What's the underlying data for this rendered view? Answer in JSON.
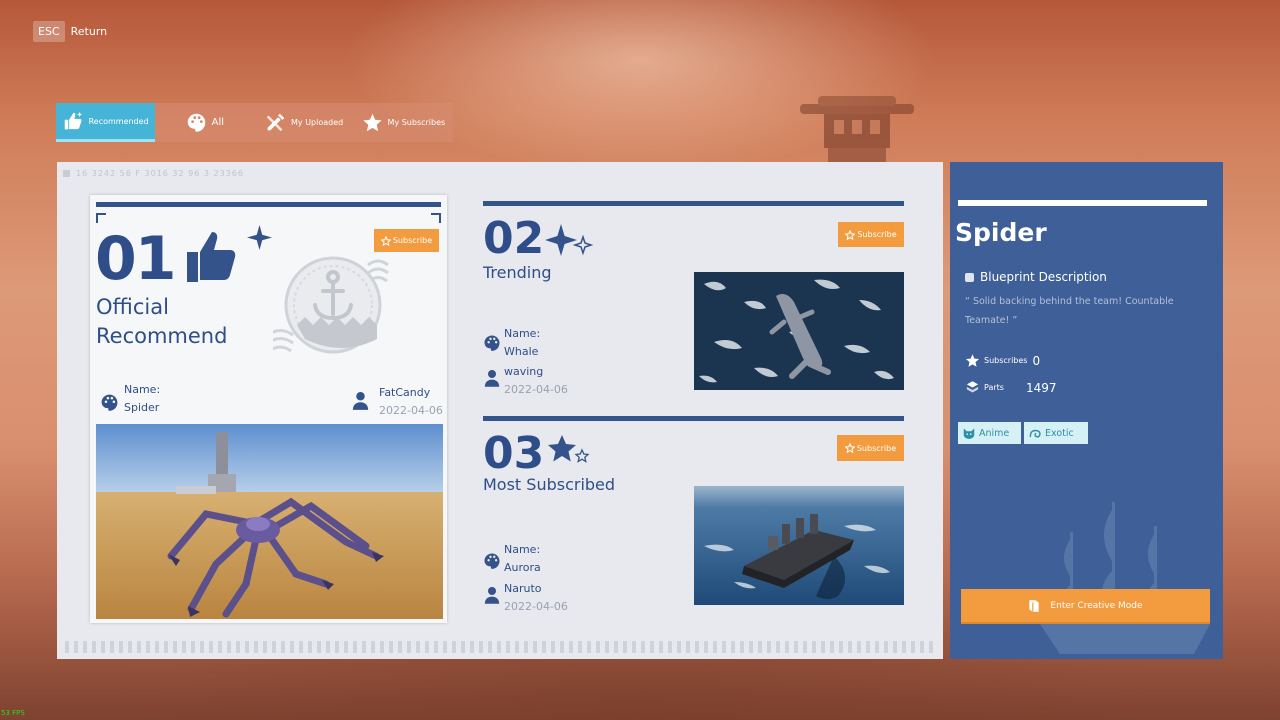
{
  "topbar": {
    "key": "ESC",
    "return_label": "Return"
  },
  "tabs": [
    {
      "label": "Recommended",
      "icon": "thumbs-up-icon",
      "active": true
    },
    {
      "label": "All",
      "icon": "palette-icon",
      "active": false
    },
    {
      "label": "My Uploaded",
      "icon": "pencil-ruler-icon",
      "active": false
    },
    {
      "label": "My Subscribes",
      "icon": "star-icon",
      "active": false
    }
  ],
  "panel_stats": "16 3242 56 F 3016 32 96 3 23366",
  "featured": {
    "rank": "01",
    "title": "Official Recommend",
    "subscribe_label": "Subscribe",
    "name_label": "Name:",
    "name": "Spider",
    "author": "FatCandy",
    "date": "2022-04-06"
  },
  "trending": {
    "rank": "02",
    "title": "Trending",
    "subscribe_label": "Subscribe",
    "name_label": "Name:",
    "name": "Whale",
    "author": "waving",
    "date": "2022-04-06"
  },
  "most_subscribed": {
    "rank": "03",
    "title": "Most Subscribed",
    "subscribe_label": "Subscribe",
    "name_label": "Name:",
    "name": "Aurora",
    "author": "Naruto",
    "date": "2022-04-06"
  },
  "detail": {
    "title": "Spider",
    "desc_label": "Blueprint Description",
    "description": "“ Solid backing behind the team!   Countable Teamate! ”",
    "subscribes_label": "Subscribes",
    "subscribes_value": "0",
    "parts_label": "Parts",
    "parts_value": "1497",
    "tags": [
      {
        "label": "Anime",
        "icon": "cat-icon"
      },
      {
        "label": "Exotic",
        "icon": "swirl-icon"
      }
    ],
    "enter_label": "Enter Creative Mode"
  },
  "fps": "53 FPS",
  "colors": {
    "accent": "#46b4d6",
    "navy": "#35538b",
    "orange": "#f29b3f",
    "panel_blue": "#3e5f97"
  }
}
